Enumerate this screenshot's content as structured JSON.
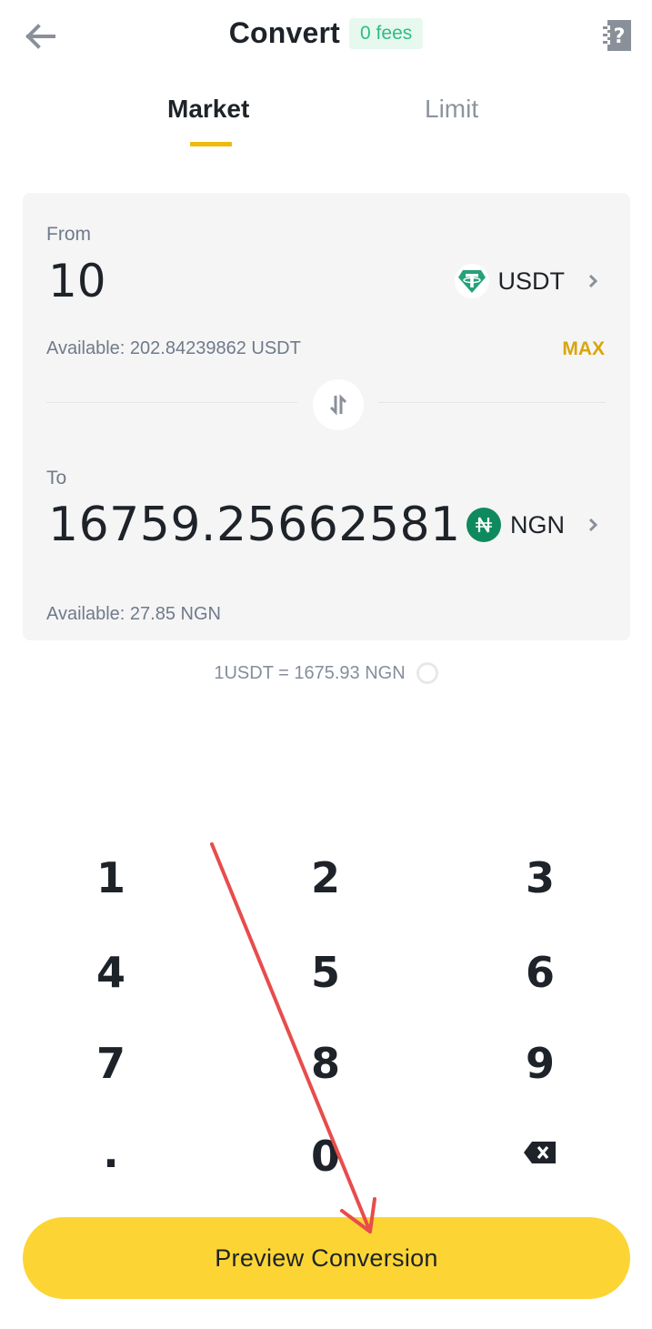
{
  "header": {
    "title": "Convert",
    "fees_badge": "0 fees",
    "back_icon": "arrow-left-icon",
    "help_icon": "help-notebook-icon"
  },
  "tabs": [
    {
      "label": "Market",
      "active": true
    },
    {
      "label": "Limit",
      "active": false
    }
  ],
  "from": {
    "label": "From",
    "amount": "10",
    "asset": "USDT",
    "asset_icon": "tether-icon",
    "available": "Available: 202.84239862 USDT",
    "max_label": "MAX"
  },
  "to": {
    "label": "To",
    "amount": "16759.25662581",
    "asset": "NGN",
    "asset_icon": "naira-icon",
    "available": "Available: 27.85 NGN"
  },
  "rate": "1USDT = 1675.93 NGN",
  "keypad": {
    "keys": [
      "1",
      "2",
      "3",
      "4",
      "5",
      "6",
      "7",
      "8",
      "9",
      ".",
      "0",
      "backspace"
    ]
  },
  "cta_label": "Preview Conversion",
  "colors": {
    "accent_yellow": "#fcd535",
    "tab_underline": "#f0b90b",
    "max": "#d8a60a",
    "fees_green": "#2ebd85",
    "tether_green": "#26a17b",
    "naira_green": "#0f8a5f",
    "annotation_red": "#e84c4c"
  }
}
